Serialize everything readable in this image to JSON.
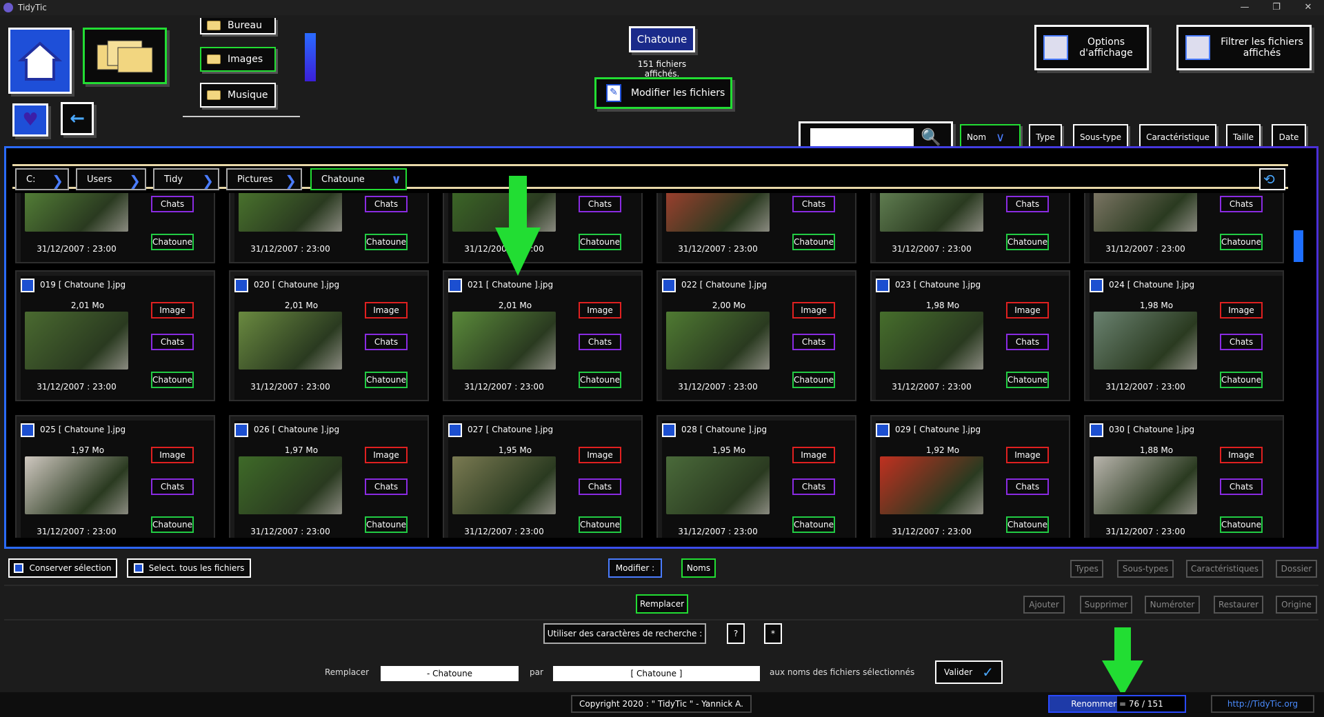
{
  "window": {
    "title": "TidyTic"
  },
  "top": {
    "folders": [
      "Bureau",
      "Images",
      "Musique"
    ],
    "current_folder": "Chatoune",
    "files_shown": "151 fichiers affichés.",
    "modify_files": "Modifier les fichiers",
    "options_display": "Options d'affichage",
    "filter_files": "Filtrer les fichiers affichés"
  },
  "sort_tabs": [
    "Nom",
    "Type",
    "Sous-type",
    "Caractéristique",
    "Taille",
    "Date"
  ],
  "breadcrumb": [
    "C:",
    "Users",
    "Tidy",
    "Pictures",
    "Chatoune"
  ],
  "cards": [
    {
      "name": "",
      "size": "",
      "date": "31/12/2007 : 23:00",
      "type": "",
      "subtype": "Chats",
      "char": "Chatoune",
      "color": "#5a8a3a"
    },
    {
      "name": "",
      "size": "",
      "date": "31/12/2007 : 23:00",
      "type": "",
      "subtype": "Chats",
      "char": "Chatoune",
      "color": "#4f7d2f"
    },
    {
      "name": "",
      "size": "",
      "date": "31/12/2007 : 23:00",
      "type": "",
      "subtype": "Chats",
      "char": "Chatoune",
      "color": "#3f6e28"
    },
    {
      "name": "",
      "size": "",
      "date": "31/12/2007 : 23:00",
      "type": "",
      "subtype": "Chats",
      "char": "Chatoune",
      "color": "#b04030"
    },
    {
      "name": "",
      "size": "",
      "date": "31/12/2007 : 23:00",
      "type": "",
      "subtype": "Chats",
      "char": "Chatoune",
      "color": "#6a8a5a"
    },
    {
      "name": "",
      "size": "",
      "date": "31/12/2007 : 23:00",
      "type": "",
      "subtype": "Chats",
      "char": "Chatoune",
      "color": "#8a8070"
    },
    {
      "name": "019 [ Chatoune ].jpg",
      "size": "2,01 Mo",
      "date": "31/12/2007 : 23:00",
      "type": "Image",
      "subtype": "Chats",
      "char": "Chatoune",
      "color": "#4a6a30"
    },
    {
      "name": "020 [ Chatoune ].jpg",
      "size": "2,01 Mo",
      "date": "31/12/2007 : 23:00",
      "type": "Image",
      "subtype": "Chats",
      "char": "Chatoune",
      "color": "#6a8a40"
    },
    {
      "name": "021 [ Chatoune ].jpg",
      "size": "2,01 Mo",
      "date": "31/12/2007 : 23:00",
      "type": "Image",
      "subtype": "Chats",
      "char": "Chatoune",
      "color": "#5a8a3a"
    },
    {
      "name": "022 [ Chatoune ].jpg",
      "size": "2,00 Mo",
      "date": "31/12/2007 : 23:00",
      "type": "Image",
      "subtype": "Chats",
      "char": "Chatoune",
      "color": "#4f7a32"
    },
    {
      "name": "023 [ Chatoune ].jpg",
      "size": "1,98 Mo",
      "date": "31/12/2007 : 23:00",
      "type": "Image",
      "subtype": "Chats",
      "char": "Chatoune",
      "color": "#466e2c"
    },
    {
      "name": "024 [ Chatoune ].jpg",
      "size": "1,98 Mo",
      "date": "31/12/2007 : 23:00",
      "type": "Image",
      "subtype": "Chats",
      "char": "Chatoune",
      "color": "#6a8270"
    },
    {
      "name": "025 [ Chatoune ].jpg",
      "size": "1,97 Mo",
      "date": "31/12/2007 : 23:00",
      "type": "Image",
      "subtype": "Chats",
      "char": "Chatoune",
      "color": "#cfc8c0"
    },
    {
      "name": "026 [ Chatoune ].jpg",
      "size": "1,97 Mo",
      "date": "31/12/2007 : 23:00",
      "type": "Image",
      "subtype": "Chats",
      "char": "Chatoune",
      "color": "#3e6a28"
    },
    {
      "name": "027 [ Chatoune ].jpg",
      "size": "1,95 Mo",
      "date": "31/12/2007 : 23:00",
      "type": "Image",
      "subtype": "Chats",
      "char": "Chatoune",
      "color": "#7a7a52"
    },
    {
      "name": "028 [ Chatoune ].jpg",
      "size": "1,95 Mo",
      "date": "31/12/2007 : 23:00",
      "type": "Image",
      "subtype": "Chats",
      "char": "Chatoune",
      "color": "#4a6a3a"
    },
    {
      "name": "029 [ Chatoune ].jpg",
      "size": "1,92 Mo",
      "date": "31/12/2007 : 23:00",
      "type": "Image",
      "subtype": "Chats",
      "char": "Chatoune",
      "color": "#c03020"
    },
    {
      "name": "030 [ Chatoune ].jpg",
      "size": "1,88 Mo",
      "date": "31/12/2007 : 23:00",
      "type": "Image",
      "subtype": "Chats",
      "char": "Chatoune",
      "color": "#b8b4ac"
    }
  ],
  "actions": {
    "keep_selection": "Conserver sélection",
    "select_all": "Select. tous les fichiers",
    "modify": "Modifier :",
    "names": "Noms",
    "types": "Types",
    "subtypes": "Sous-types",
    "chars": "Caractéristiques",
    "folder": "Dossier",
    "replace": "Remplacer",
    "add": "Ajouter",
    "delete": "Supprimer",
    "number": "Numéroter",
    "restore": "Restaurer",
    "origin": "Origine",
    "search_chars": "Utiliser des caractères de recherche :",
    "q": "?",
    "star": "*"
  },
  "replace": {
    "label": "Remplacer",
    "from": "- Chatoune",
    "by": "par",
    "to": "[ Chatoune ]",
    "suffix": "aux noms des fichiers sélectionnés",
    "validate": "Valider"
  },
  "footer": {
    "copyright": "Copyright 2020 : \" TidyTic \" - Yannick A.",
    "progress_label": "Renommer",
    "progress_text": "= 76 / 151",
    "progress": 0.5,
    "link": "http://TidyTic.org"
  }
}
